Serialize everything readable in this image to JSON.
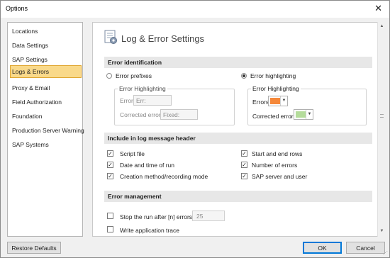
{
  "window": {
    "title": "Options",
    "close_glyph": "✕"
  },
  "sidebar": {
    "items": [
      {
        "label": "Locations"
      },
      {
        "label": "Data Settings"
      },
      {
        "label": "SAP Settings"
      },
      {
        "label": "Logs & Errors",
        "selected": true
      },
      {
        "label": "Proxy & Email"
      },
      {
        "label": "Field Authorization"
      },
      {
        "label": "Foundation"
      },
      {
        "label": "Production Server Warning"
      },
      {
        "label": "SAP Systems"
      }
    ]
  },
  "header": {
    "title": "Log & Error Settings",
    "icon": "settings-document-icon"
  },
  "error_identification": {
    "heading": "Error identification",
    "prefixes": {
      "label": "Error prefixes",
      "selected": false,
      "group_title": "Error Highlighting",
      "errors_label": "Errors:",
      "errors_value": "Err:",
      "corrected_label": "Corrected errors:",
      "corrected_value": "Fixed:"
    },
    "highlighting": {
      "label": "Error highlighting",
      "selected": true,
      "group_title": "Error Highlighting",
      "errors_label": "Errors:",
      "errors_color": "#f5883a",
      "corrected_label": "Corrected errors:",
      "corrected_color": "#b4dc9a"
    }
  },
  "log_header": {
    "heading": "Include in log message header",
    "left": [
      {
        "label": "Script file",
        "checked": true
      },
      {
        "label": "Date and time of run",
        "checked": true
      },
      {
        "label": "Creation method/recording mode",
        "checked": true
      }
    ],
    "right": [
      {
        "label": "Start and end rows",
        "checked": true
      },
      {
        "label": "Number of errors",
        "checked": true
      },
      {
        "label": "SAP server and user",
        "checked": true
      }
    ]
  },
  "error_management": {
    "heading": "Error management",
    "stop_run": {
      "label": "Stop the run after [n] errors:",
      "checked": false,
      "value": "25"
    },
    "app_trace": {
      "label": "Write application trace",
      "checked": false
    }
  },
  "footer": {
    "restore_label": "Restore Defaults",
    "ok_label": "OK",
    "cancel_label": "Cancel"
  },
  "check_glyph": "✓",
  "dropdown_glyph": "▼",
  "scroll_up_glyph": "▲",
  "scroll_down_glyph": "▼",
  "resize_glyph": "⋰"
}
